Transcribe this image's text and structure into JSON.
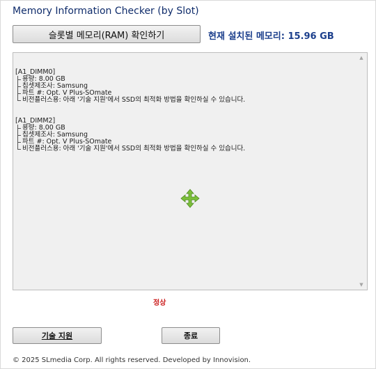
{
  "app": {
    "title": "Memory Information Checker (by Slot)"
  },
  "toolbar": {
    "check_button_label": "슬롯별 메모리(RAM) 확인하기",
    "installed_memory_label": "현재 설치된 메모리: 15.96 GB"
  },
  "slots": [
    {
      "header": "[A1_DIMM0]",
      "items": [
        "용량: 8.00 GB",
        "칩셋제조사: Samsung",
        "파트 #: Opt. V Plus-SOmate",
        "비전플러스용: 아래 '기술 지원'에서 SSD의 최적화 방법을 확인하실 수 있습니다."
      ]
    },
    {
      "header": "[A1_DIMM2]",
      "items": [
        "용량: 8.00 GB",
        "칩셋제조사: Samsung",
        "파트 #: Opt. V Plus-SOmate",
        "비전플러스용: 아래 '기술 지원'에서 SSD의 최적화 방법을 확인하실 수 있습니다."
      ]
    }
  ],
  "status": {
    "text": "정상",
    "color": "#cc1f1f"
  },
  "buttons": {
    "support_label": "기술 지원",
    "exit_label": "종료"
  },
  "footer": {
    "copyright": "© 2025 SLmedia Corp. All rights reserved. Developed by Innovision."
  },
  "icons": {
    "scroll_up": "scroll-up-arrow-icon",
    "scroll_down": "scroll-down-arrow-icon",
    "cursor": "move-cursor-icon"
  },
  "colors": {
    "title": "#0f2c6b",
    "memory_label": "#1c3f8c",
    "cursor": "#7cbf3a"
  }
}
